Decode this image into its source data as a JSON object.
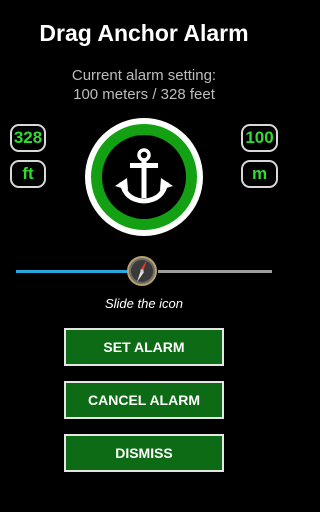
{
  "title": "Drag Anchor Alarm",
  "alarm_setting": {
    "label": "Current alarm setting:",
    "value": "100 meters / 328 feet"
  },
  "feet": {
    "value": "328",
    "unit": "ft"
  },
  "meters": {
    "value": "100",
    "unit": "m"
  },
  "anchor_icon": "anchor-icon",
  "slider": {
    "hint": "Slide the icon",
    "handle_icon": "compass-icon",
    "active_color": "#29a7e0",
    "inactive_color": "#9e9e9e"
  },
  "buttons": {
    "set_alarm": "SET ALARM",
    "cancel_alarm": "CANCEL ALARM",
    "dismiss": "DISMISS"
  },
  "colors": {
    "accent_green": "#13a113",
    "button_green": "#0c6b14",
    "value_green": "#2fdc2f"
  }
}
